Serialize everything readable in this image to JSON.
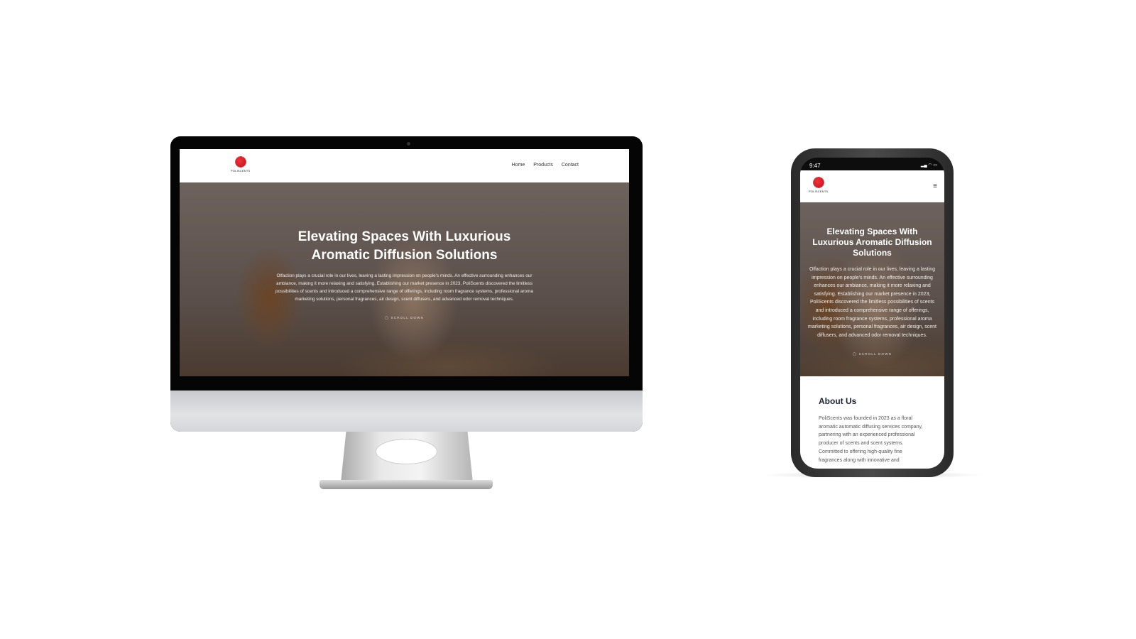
{
  "brand": {
    "logo_text": "POLISCENTS",
    "accent": "#d4151f"
  },
  "desktop": {
    "nav": [
      "Home",
      "Products",
      "Contact"
    ],
    "hero": {
      "title": "Elevating Spaces With Luxurious Aromatic Diffusion Solutions",
      "body": "Olfaction plays a crucial role in our lives, leaving a lasting impression on people's minds. An effective surrounding enhances our ambiance, making it more relaxing and satisfying. Establishing our market presence in 2023, PoliScents discovered the limitless possibilities of scents and introduced a comprehensive range of offerings, including room fragrance systems, professional aroma marketing solutions, personal fragrances, air design, scent diffusers, and advanced odor removal techniques.",
      "scroll": "SCROLL DOWN"
    }
  },
  "mobile": {
    "time": "9:47",
    "status_icons": "signal wifi battery",
    "menu_icon": "hamburger-icon",
    "hero": {
      "title": "Elevating Spaces With Luxurious Aromatic Diffusion Solutions",
      "body": "Olfaction plays a crucial role in our lives, leaving a lasting impression on people's minds. An effective surrounding enhances our ambiance, making it more relaxing and satisfying. Establishing our market presence in 2023, PoliScents discovered the limitless possibilities of scents and introduced a comprehensive range of offerings, including room fragrance systems, professional aroma marketing solutions, personal fragrances, air design, scent diffusers, and advanced odor removal techniques.",
      "scroll": "SCROLL DOWN"
    },
    "about": {
      "title": "About Us",
      "body": "PoliScents was founded in 2023 as a floral aromatic automatic diffusing services company, partnering with an experienced professional producer of scents and scent systems. Committed to offering high-quality fine fragrances along with innovative and"
    }
  }
}
